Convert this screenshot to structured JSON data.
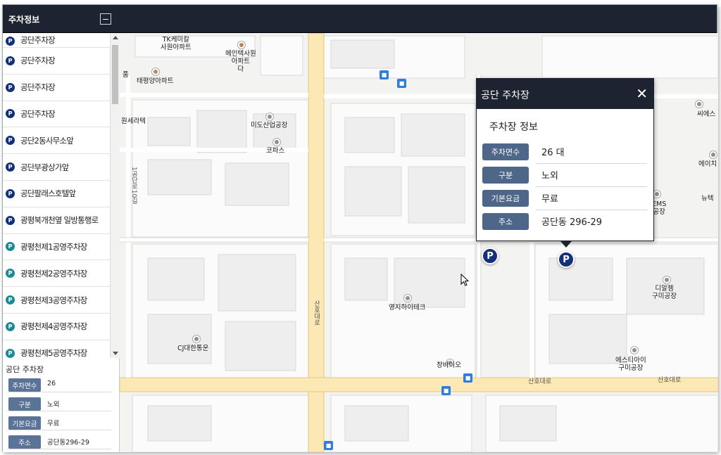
{
  "window": {
    "title": "주차정보"
  },
  "sidebar": {
    "items": [
      {
        "label": "공단주차장",
        "icon": "parking-icon",
        "color": "#13307b"
      },
      {
        "label": "공단주차장",
        "icon": "parking-icon",
        "color": "#13307b"
      },
      {
        "label": "공단주차장",
        "icon": "parking-icon",
        "color": "#13307b"
      },
      {
        "label": "공단주차장",
        "icon": "parking-icon",
        "color": "#13307b"
      },
      {
        "label": "공단2동사무소앞",
        "icon": "parking-icon",
        "color": "#13307b"
      },
      {
        "label": "공단부광상가앞",
        "icon": "parking-icon",
        "color": "#13307b"
      },
      {
        "label": "공단팔래스호텔앞",
        "icon": "parking-icon",
        "color": "#13307b"
      },
      {
        "label": "광평북개천옆 일방통행로",
        "icon": "parking-icon",
        "color": "#13307b"
      },
      {
        "label": "광평천제1공영주차장",
        "icon": "parking-icon",
        "color": "#1b8a96"
      },
      {
        "label": "광평천제2공영주차장",
        "icon": "parking-icon",
        "color": "#1b8a96"
      },
      {
        "label": "광평천제3공영주차장",
        "icon": "parking-icon",
        "color": "#1b8a96"
      },
      {
        "label": "광평천제4공영주차장",
        "icon": "parking-icon",
        "color": "#1b8a96"
      },
      {
        "label": "광평천제5공영주차장",
        "icon": "parking-icon",
        "color": "#1b8a96"
      }
    ],
    "detail": {
      "title": "공단 주차장",
      "rows": [
        {
          "label": "주차면수",
          "value": "26"
        },
        {
          "label": "구분",
          "value": "노외"
        },
        {
          "label": "기본요금",
          "value": "무료"
        },
        {
          "label": "주소",
          "value": "공단동296-29"
        }
      ]
    }
  },
  "map": {
    "pois": {
      "tk": "TK케미칼\n사원아파트",
      "mein": "메인텍사원\n아파트\n다",
      "taepyeong": "태평양아파트",
      "pum": "품",
      "won": "원세라텍",
      "mido": "미도산업공장",
      "kopas": "코파스",
      "youngji": "영지하이테크",
      "cj": "CJ대한통운",
      "changbio": "창바이오",
      "diall": "디알젬\n구미공장",
      "esty": "에스티아이\n구미공장",
      "ems": "EMS\n공장",
      "cie": "씨에스",
      "eichi": "에이치",
      "nyu": "뉴텍"
    },
    "roads": {
      "sanho_vertical": "산호대로",
      "sanho_bottom_1": "산호대로",
      "sanho_bottom_2": "산호대로",
      "gongdan": "1공단로10길"
    },
    "popup": {
      "title": "공단 주차장",
      "subtitle": "주차장 정보",
      "rows": [
        {
          "label": "주차면수",
          "value": "26 대"
        },
        {
          "label": "구분",
          "value": "노외"
        },
        {
          "label": "기본요금",
          "value": "무료"
        },
        {
          "label": "주소",
          "value": "공단동 296-29"
        }
      ],
      "close": "✕"
    },
    "marker_label": "P"
  }
}
